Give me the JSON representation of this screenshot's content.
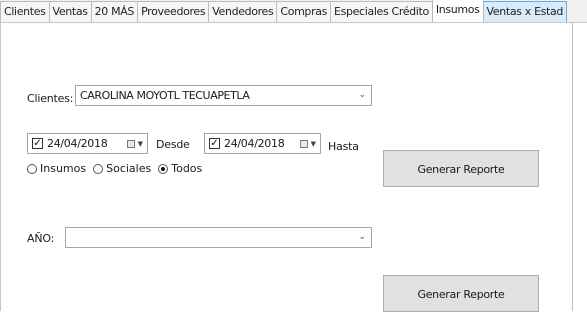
{
  "tabs": [
    {
      "label": "Clientes"
    },
    {
      "label": "Ventas"
    },
    {
      "label": "20 MÁS"
    },
    {
      "label": "Proveedores"
    },
    {
      "label": "Vendedores"
    },
    {
      "label": "Compras"
    },
    {
      "label": "Especiales Crédito"
    },
    {
      "label": "Insumos"
    },
    {
      "label": "Ventas x Estad"
    }
  ],
  "clientes": {
    "label": "Clientes:",
    "value": "CAROLINA MOYOTL TECUAPETLA"
  },
  "date_from": {
    "checked": true,
    "value": "24/04/2018",
    "label": "Desde"
  },
  "date_to": {
    "checked": true,
    "value": "24/04/2018",
    "label": "Hasta"
  },
  "radios": [
    {
      "label": "Insumos",
      "selected": false
    },
    {
      "label": "Sociales",
      "selected": false
    },
    {
      "label": "Todos",
      "selected": true
    }
  ],
  "generate_button_1": "Generar Reporte",
  "anio": {
    "label": "AÑO:",
    "value": ""
  },
  "generate_button_2": "Generar Reporte"
}
